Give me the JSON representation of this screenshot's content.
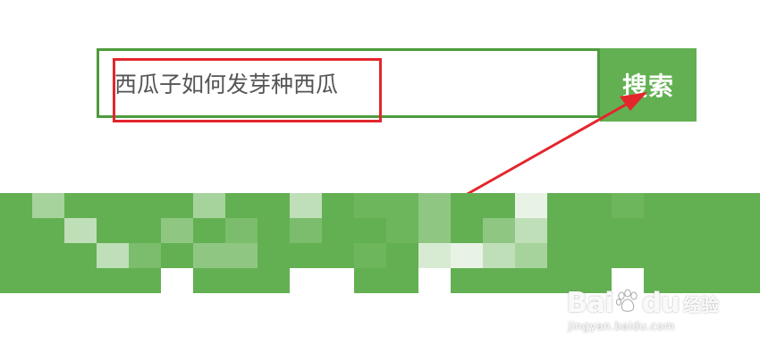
{
  "search": {
    "query": "西瓜子如何发芽种西瓜",
    "button_label": "搜索"
  },
  "watermark": {
    "logo_left": "Bai",
    "logo_right": "du",
    "product": "经验",
    "url": "jingyan.baidu.com"
  },
  "colors": {
    "brand_green": "#63b052",
    "border_green": "#4d9b3c",
    "annotation_red": "#e3262c"
  },
  "icons": {
    "paw": "baidu-paw-icon",
    "arrow": "annotation-arrow"
  }
}
